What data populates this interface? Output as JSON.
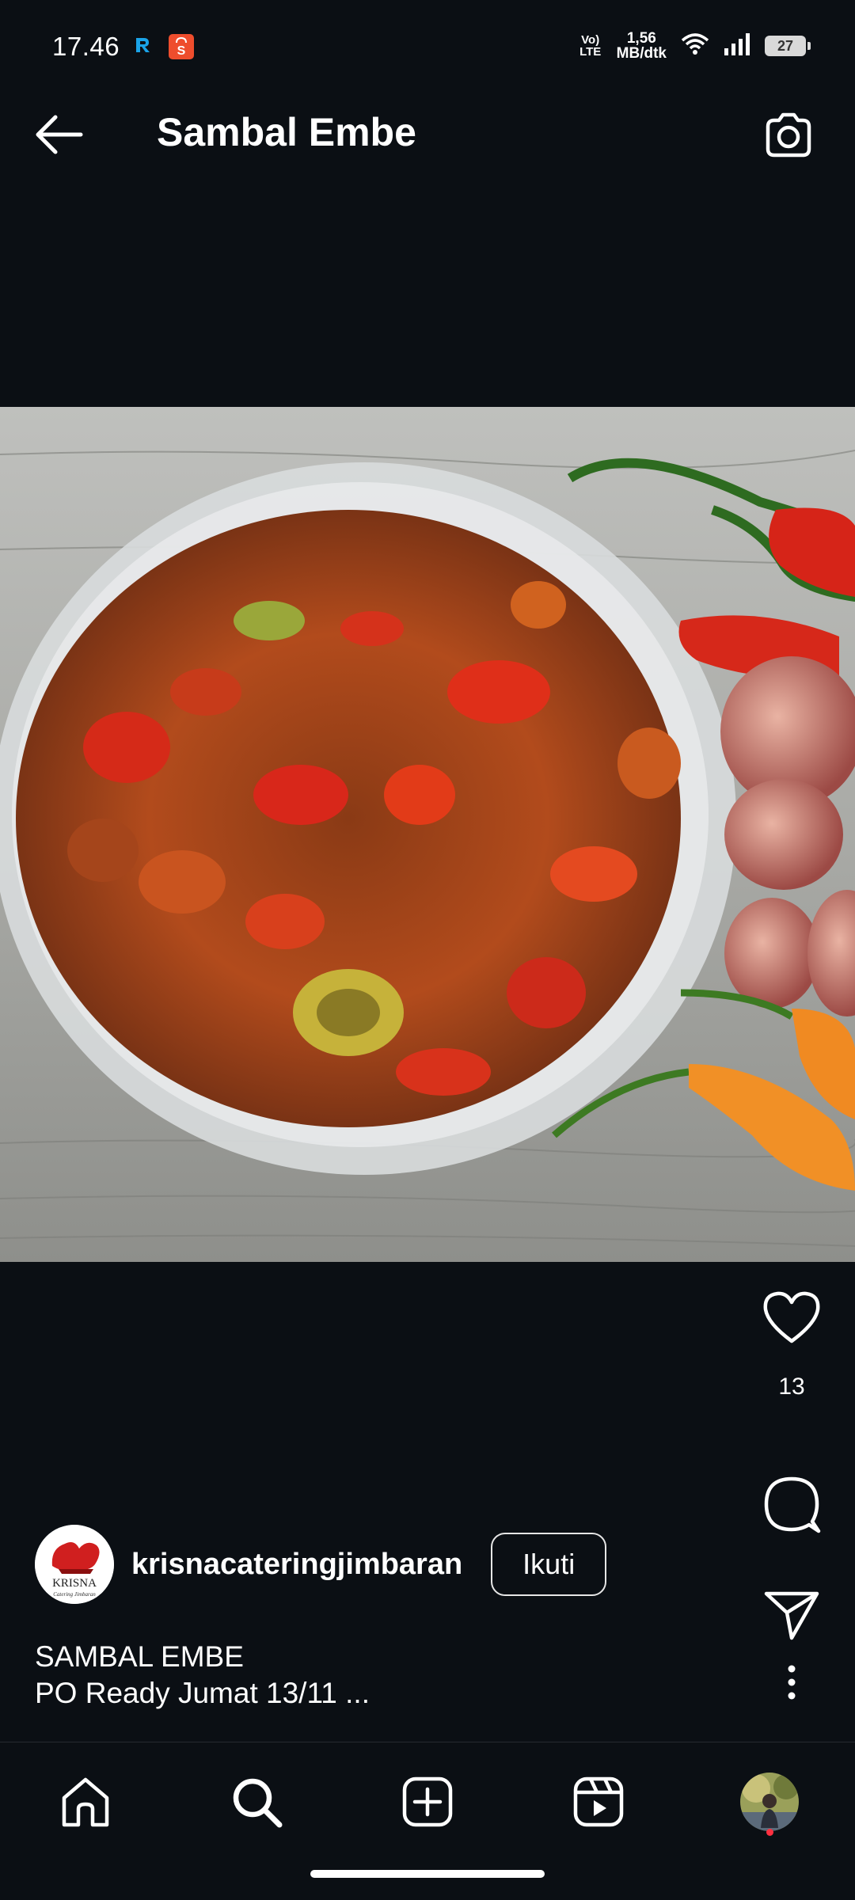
{
  "status": {
    "time": "17.46",
    "network_label": "Vo) LTE",
    "speed_value": "1,56",
    "speed_unit": "MB/dtk",
    "battery": "27"
  },
  "header": {
    "title": "Sambal Embe"
  },
  "post": {
    "likes": "13",
    "author": "krisnacateringjimbaran",
    "follow_label": "Ikuti",
    "caption_line1": "SAMBAL EMBE",
    "caption_line2": "PO Ready Jumat 13/11 ...",
    "avatar_logo_text": "KRISNA",
    "avatar_logo_sub": "Catering Jimbaran"
  },
  "icons": {
    "back": "arrow-left-icon",
    "camera": "camera-icon",
    "like": "heart-icon",
    "comment": "comment-icon",
    "share": "send-icon",
    "more": "more-vertical-icon",
    "nav_home": "home-icon",
    "nav_search": "search-icon",
    "nav_create": "plus-square-icon",
    "nav_reels": "reels-icon",
    "nav_profile": "profile-avatar"
  },
  "colors": {
    "background": "#0b0f14",
    "text": "#ffffff",
    "notification_dot": "#ff3040"
  }
}
